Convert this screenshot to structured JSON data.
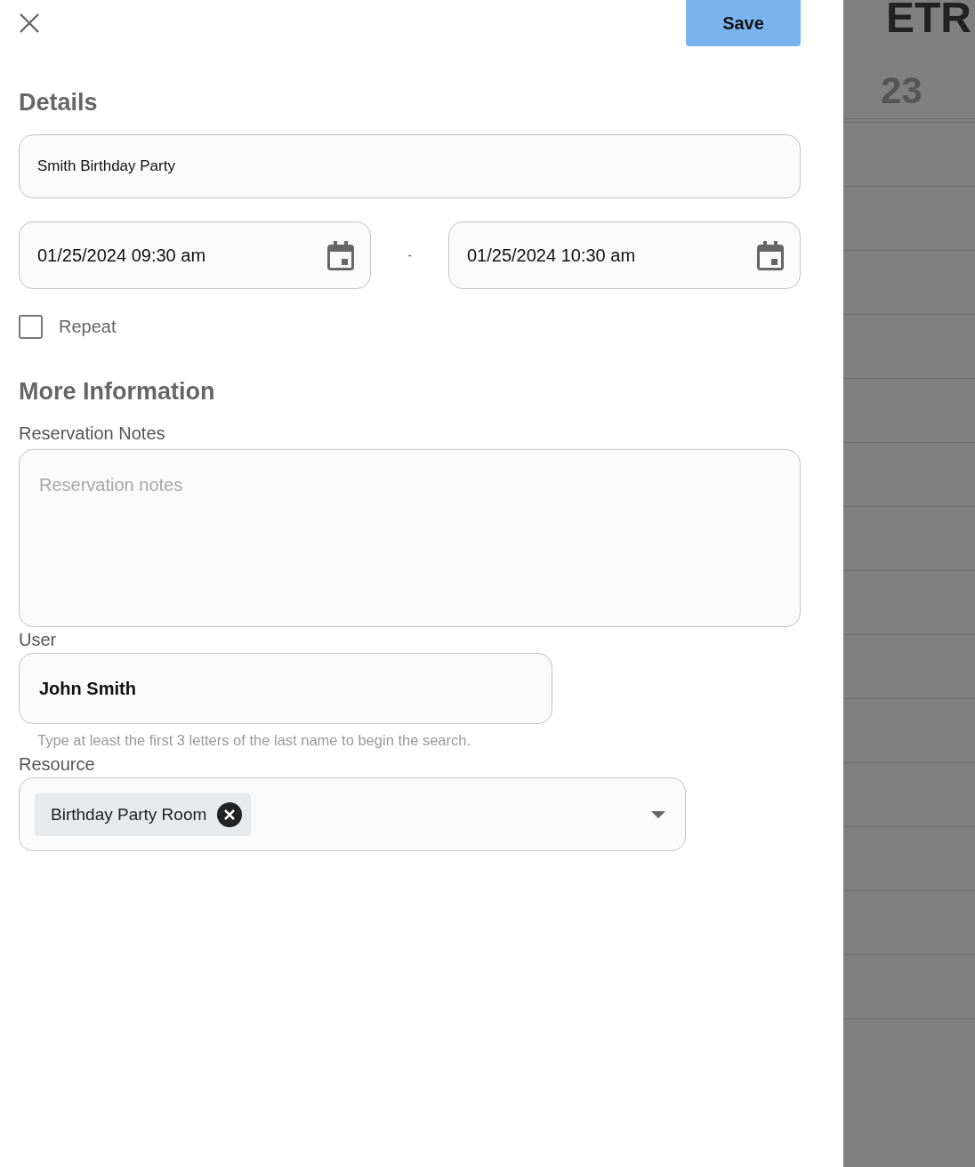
{
  "header": {
    "save_button": "Save"
  },
  "details": {
    "heading": "Details",
    "title_value": "Smith Birthday Party",
    "start": "01/25/2024 09:30 am",
    "separator": "-",
    "end": "01/25/2024 10:30 am",
    "repeat": {
      "label": "Repeat",
      "checked": false
    }
  },
  "more_information": {
    "heading": "More Information",
    "notes_label": "Reservation Notes",
    "notes_placeholder": "Reservation notes",
    "user_label": "User",
    "user_value": "John Smith",
    "user_hint": "Type at least the first 3 letters of the last name to begin the search.",
    "resource_label": "Resource",
    "resource_chips": [
      "Birthday Party Room"
    ]
  },
  "background": {
    "title": "ETR",
    "day": "23"
  }
}
